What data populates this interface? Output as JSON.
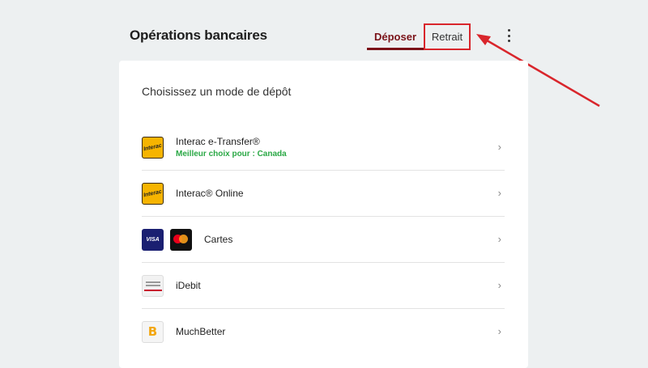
{
  "header": {
    "title": "Opérations bancaires",
    "tabs": [
      {
        "label": "Déposer",
        "active": true
      },
      {
        "label": "Retrait",
        "active": false
      }
    ],
    "menu_icon": "kebab-menu-icon"
  },
  "panel": {
    "heading": "Choisissez un mode de dépôt",
    "methods": [
      {
        "name": "Interac e-Transfer®",
        "subtitle": "Meilleur choix pour : Canada",
        "logo": "interac",
        "logo_text": "Interac"
      },
      {
        "name": "Interac® Online",
        "logo": "interac",
        "logo_text": "Interac"
      },
      {
        "name": "Cartes",
        "logo": "visa-mastercard",
        "logo_text": "VISA"
      },
      {
        "name": "iDebit",
        "logo": "idebit"
      },
      {
        "name": "MuchBetter",
        "logo": "muchbetter",
        "logo_text": "B"
      }
    ],
    "chevron": "›"
  },
  "colors": {
    "accent": "#7a1218",
    "highlight": "#d9262c",
    "success": "#2aa845",
    "background": "#edf0f1"
  }
}
